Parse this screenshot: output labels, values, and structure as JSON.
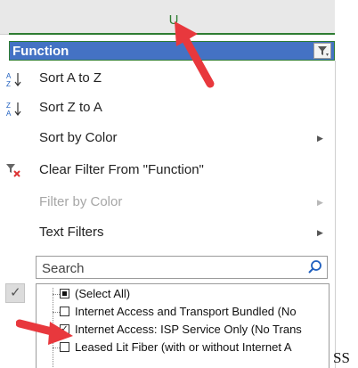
{
  "column_header": {
    "letter": "U"
  },
  "header_cell": {
    "label": "Function"
  },
  "menu": {
    "items": [
      {
        "label": "Sort A to Z",
        "icon": "sort-a-z-icon",
        "enabled": true,
        "submenu": false
      },
      {
        "label": "Sort Z to A",
        "icon": "sort-z-a-icon",
        "enabled": true,
        "submenu": false
      },
      {
        "label": "Sort by Color",
        "icon": "",
        "enabled": true,
        "submenu": true
      },
      {
        "label": "Clear Filter From \"Function\"",
        "icon": "clear-filter-icon",
        "enabled": true,
        "submenu": false
      },
      {
        "label": "Filter by Color",
        "icon": "",
        "enabled": false,
        "submenu": true
      },
      {
        "label": "Text Filters",
        "icon": "",
        "enabled": true,
        "submenu": true
      }
    ]
  },
  "search": {
    "placeholder": "Search"
  },
  "values_list": [
    {
      "label": "(Select All)",
      "state": "partial"
    },
    {
      "label": "Internet Access and Transport Bundled (No",
      "state": "unchecked"
    },
    {
      "label": "Internet Access: ISP Service Only (No Trans",
      "state": "checked"
    },
    {
      "label": "Leased Lit Fiber (with or without Internet A",
      "state": "unchecked"
    }
  ],
  "trailing_text": "SS",
  "colors": {
    "header_blue": "#4472c4",
    "selection_green": "#2e7d32",
    "annotation_red": "#e8383d",
    "disabled_gray": "#a6a6a6"
  }
}
